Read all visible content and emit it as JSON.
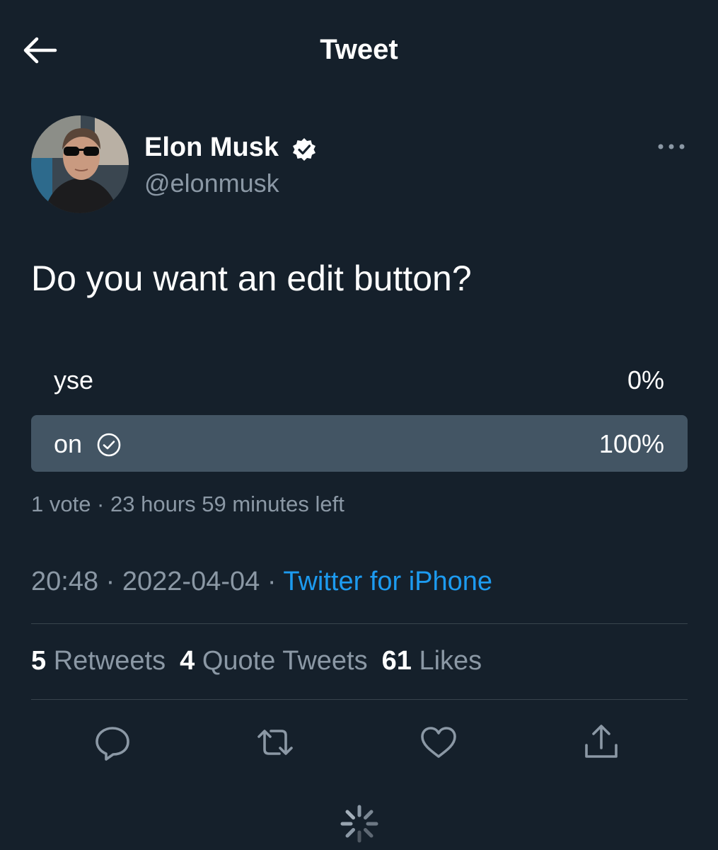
{
  "header": {
    "title": "Tweet",
    "back_icon": "arrow-left-icon"
  },
  "author": {
    "display_name": "Elon Musk",
    "handle": "@elonmusk",
    "verified": true,
    "more_icon": "ellipsis-icon"
  },
  "tweet": {
    "text": "Do you want an edit button?"
  },
  "poll": {
    "options": [
      {
        "label": "yse",
        "percent_text": "0%",
        "share": 0.0,
        "selected": false
      },
      {
        "label": "on",
        "percent_text": "100%",
        "share": 1.0,
        "selected": true
      }
    ],
    "meta": "1 vote · 23 hours 59 minutes left"
  },
  "timestamp": {
    "time": "20:48",
    "date": "2022-04-04",
    "source": "Twitter for iPhone"
  },
  "stats": {
    "retweets_count": "5",
    "retweets_label": "Retweets",
    "quotes_count": "4",
    "quotes_label": "Quote Tweets",
    "likes_count": "61",
    "likes_label": "Likes"
  },
  "actions": [
    "reply-icon",
    "retweet-icon",
    "like-icon",
    "share-icon"
  ],
  "colors": {
    "background": "#15202b",
    "secondary_text": "#8b98a5",
    "link": "#1d9bf0",
    "poll_fill": "#435564",
    "divider": "#38444d"
  }
}
